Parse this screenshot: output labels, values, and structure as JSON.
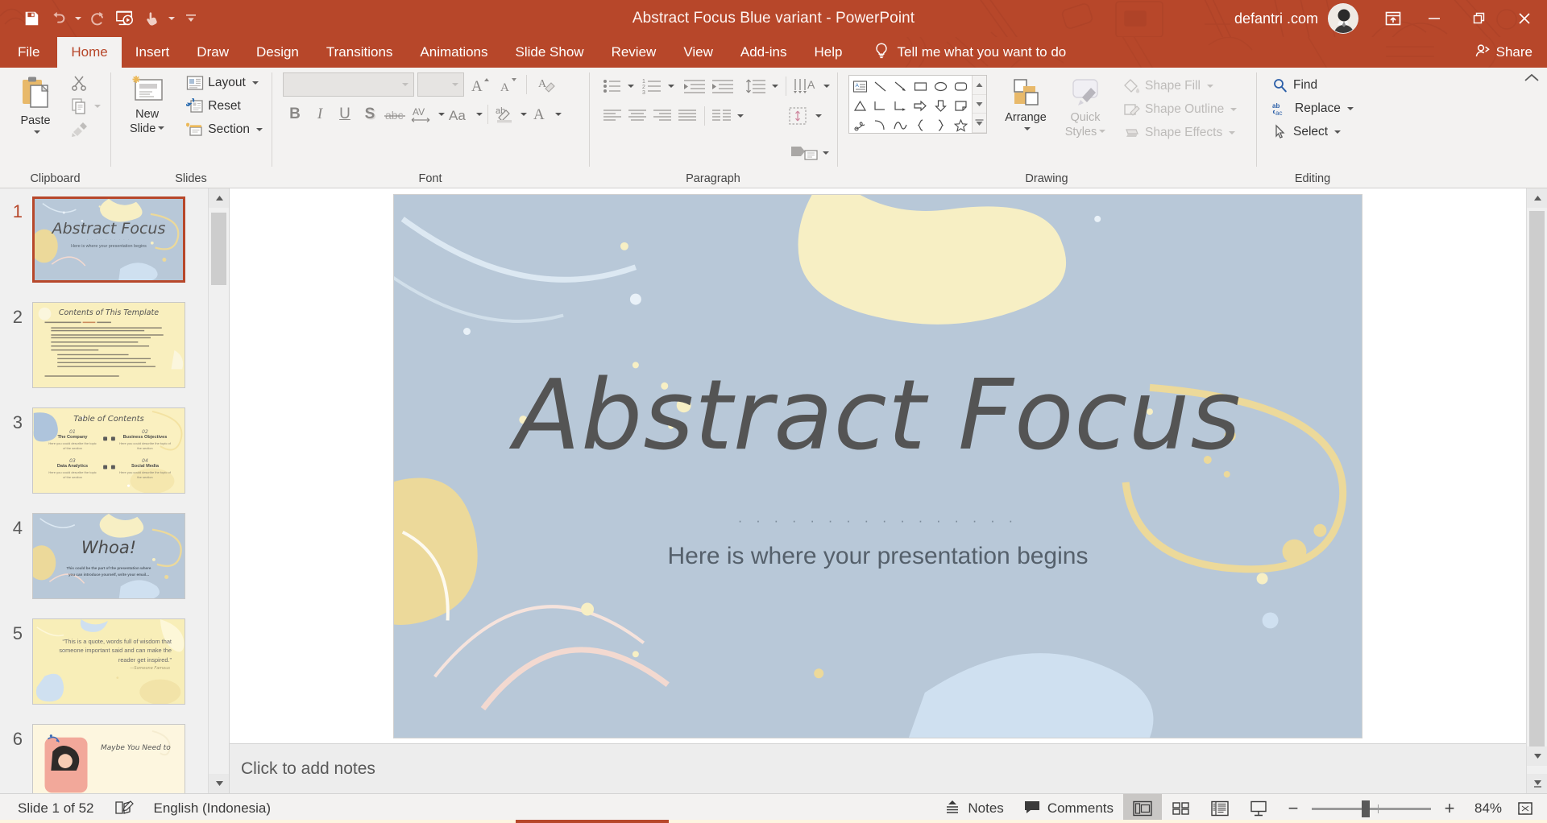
{
  "window": {
    "title": "Abstract Focus Blue variant  -  PowerPoint",
    "account_name": "defantri .com",
    "brand_color": "#b7472a",
    "minimize_label": "Minimize",
    "restore_label": "Restore Down",
    "close_label": "Close",
    "ribbon_display_label": "Ribbon Display Options"
  },
  "qat": {
    "items": [
      {
        "name": "save",
        "label": "Save"
      },
      {
        "name": "undo",
        "label": "Undo"
      },
      {
        "name": "redo",
        "label": "Repeat"
      },
      {
        "name": "start-from-beginning",
        "label": "Start From Beginning"
      },
      {
        "name": "touch-mouse-mode",
        "label": "Touch/Mouse Mode"
      },
      {
        "name": "customize",
        "label": "Customize Quick Access Toolbar"
      }
    ]
  },
  "tabs": [
    {
      "label": "File",
      "active": false
    },
    {
      "label": "Home",
      "active": true
    },
    {
      "label": "Insert",
      "active": false
    },
    {
      "label": "Draw",
      "active": false
    },
    {
      "label": "Design",
      "active": false
    },
    {
      "label": "Transitions",
      "active": false
    },
    {
      "label": "Animations",
      "active": false
    },
    {
      "label": "Slide Show",
      "active": false
    },
    {
      "label": "Review",
      "active": false
    },
    {
      "label": "View",
      "active": false
    },
    {
      "label": "Add-ins",
      "active": false
    },
    {
      "label": "Help",
      "active": false
    }
  ],
  "tellme": {
    "label": "Tell me what you want to do"
  },
  "share": {
    "label": "Share"
  },
  "ribbon": {
    "groups": [
      {
        "name": "clipboard",
        "label": "Clipboard"
      },
      {
        "name": "slides",
        "label": "Slides"
      },
      {
        "name": "font",
        "label": "Font"
      },
      {
        "name": "paragraph",
        "label": "Paragraph"
      },
      {
        "name": "drawing",
        "label": "Drawing"
      },
      {
        "name": "editing",
        "label": "Editing"
      }
    ],
    "clipboard": {
      "paste": "Paste",
      "cut": "Cut",
      "copy": "Copy",
      "format_painter": "Format Painter"
    },
    "slides": {
      "new_slide": "New\nSlide",
      "new_slide_line1": "New",
      "new_slide_line2": "Slide",
      "layout": "Layout",
      "reset": "Reset",
      "section": "Section"
    },
    "font": {
      "font_name_value": "",
      "font_name_placeholder": "",
      "font_size_value": "",
      "font_size_placeholder": "",
      "increase_size": "A",
      "decrease_size": "A",
      "clear_formatting": "Clear All Formatting",
      "bold": "B",
      "italic": "I",
      "underline": "U",
      "shadow": "S",
      "strikethrough": "abc",
      "char_spacing": "AV",
      "change_case": "Aa",
      "highlight": "ab",
      "font_color": "A"
    },
    "paragraph": {
      "bullets": "Bullets",
      "numbering": "Numbering",
      "decrease_indent": "Decrease List Level",
      "increase_indent": "Increase List Level",
      "line_spacing": "Line Spacing",
      "text_direction": "Text Direction",
      "align_text": "Align Text",
      "convert_smartart": "Convert to SmartArt",
      "align_left": "Align Left",
      "align_center": "Center",
      "align_right": "Align Right",
      "justify": "Justify",
      "columns": "Columns"
    },
    "drawing": {
      "arrange": "Arrange",
      "quick_styles_line1": "Quick",
      "quick_styles_line2": "Styles",
      "shape_fill": "Shape Fill",
      "shape_outline": "Shape Outline",
      "shape_effects": "Shape Effects",
      "shapes": [
        "text-box",
        "line",
        "line-arrow",
        "rectangle",
        "oval",
        "rounded-rectangle",
        "triangle",
        "elbow-connector",
        "elbow-arrow-connector",
        "right-arrow",
        "down-arrow",
        "folded-corner",
        "scribble",
        "arc",
        "curve",
        "left-brace",
        "right-brace",
        "star"
      ]
    },
    "editing": {
      "find": "Find",
      "replace": "Replace",
      "select": "Select"
    },
    "collapse_label": "Collapse the Ribbon"
  },
  "thumbnails": [
    {
      "number": "1",
      "selected": true,
      "kind": "title-blue",
      "title": "Abstract Focus",
      "subtitle": "Here is where your presentation begins"
    },
    {
      "number": "2",
      "selected": false,
      "kind": "contents-cream",
      "title": "Contents of This Template",
      "subtitle": ""
    },
    {
      "number": "3",
      "selected": false,
      "kind": "toc-cream",
      "title": "Table of Contents",
      "items": [
        {
          "num": "01",
          "heading": "The Company",
          "body": "Here you could describe the topic of the section"
        },
        {
          "num": "02",
          "heading": "Business Objectives",
          "body": "Here you could describe the topic of the section"
        },
        {
          "num": "03",
          "heading": "Data Analytics",
          "body": "Here you could describe the topic of the section"
        },
        {
          "num": "04",
          "heading": "Social Media",
          "body": "Here you could describe the topic of the section"
        }
      ]
    },
    {
      "number": "4",
      "selected": false,
      "kind": "whoa-blue",
      "title": "Whoa!",
      "subtitle": "This could be the part of the presentation where you can introduce yourself, write your email..."
    },
    {
      "number": "5",
      "selected": false,
      "kind": "quote-cream",
      "title": "“This is a quote, words full of wisdom that someone important said and can make the reader get inspired.”",
      "subtitle": "—Someone Famous"
    },
    {
      "number": "6",
      "selected": false,
      "kind": "photo-cream",
      "title": "Maybe You Need to",
      "subtitle": ""
    }
  ],
  "slide": {
    "title": "Abstract Focus",
    "divider": "· · · · · · · · · · · · · · · ·",
    "subtitle": "Here is where your presentation begins",
    "background_color": "#b8c8d8",
    "accent_cream": "#f7efc4",
    "accent_yellow": "#ecd99a",
    "accent_lightblue": "#cfe0f0",
    "text_color": "#545454"
  },
  "notes": {
    "placeholder": "Click to add notes"
  },
  "statusbar": {
    "slide_counter": "Slide 1 of 52",
    "spellcheck_label": "Spelling and Grammar Check",
    "language": "English (Indonesia)",
    "notes_label": "Notes",
    "comments_label": "Comments",
    "views": [
      {
        "name": "normal-view",
        "label": "Normal",
        "active": true
      },
      {
        "name": "slide-sorter-view",
        "label": "Slide Sorter",
        "active": false
      },
      {
        "name": "reading-view",
        "label": "Reading View",
        "active": false
      },
      {
        "name": "slide-show-view",
        "label": "Slide Show",
        "active": false
      }
    ],
    "zoom_out_label": "Zoom Out",
    "zoom_in_label": "Zoom In",
    "zoom_value": "84%",
    "fit_label": "Fit slide to current window"
  }
}
